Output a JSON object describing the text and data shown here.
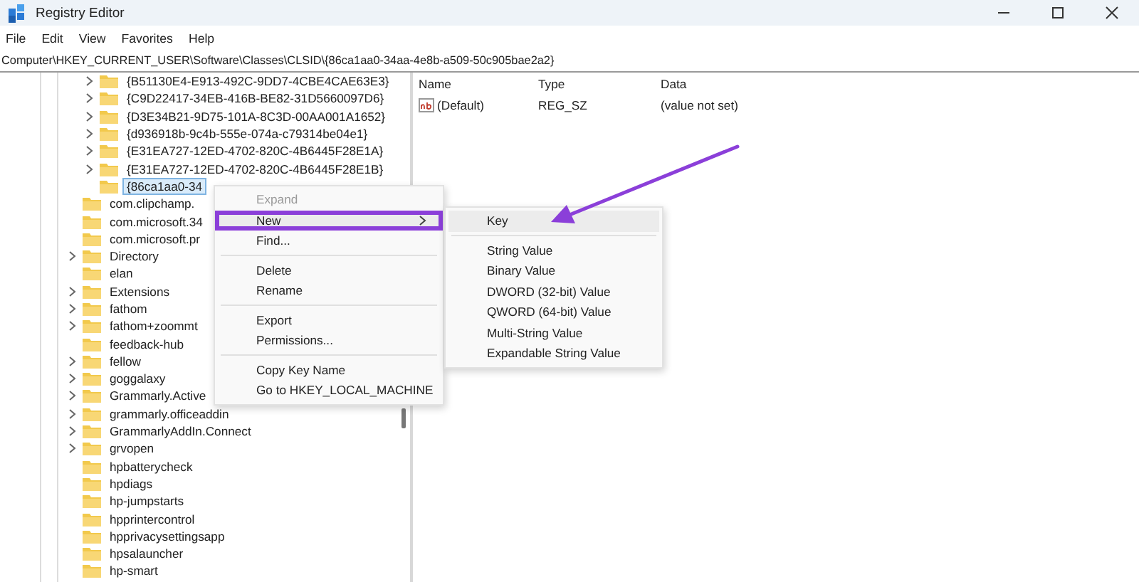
{
  "window": {
    "title": "Registry Editor"
  },
  "menu_bar": [
    "File",
    "Edit",
    "View",
    "Favorites",
    "Help"
  ],
  "address_bar": {
    "value": "Computer\\HKEY_CURRENT_USER\\Software\\Classes\\CLSID\\{86ca1aa0-34aa-4e8b-a509-50c905bae2a2}"
  },
  "tree": {
    "partial_branch": [
      {
        "label": "{B51130E4-E913-492C-9DD7-4CBE4CAE63E3}",
        "expandable": true,
        "selected": false
      },
      {
        "label": "{C9D22417-34EB-416B-BE82-31D5660097D6}",
        "expandable": true,
        "selected": false
      },
      {
        "label": "{D3E34B21-9D75-101A-8C3D-00AA001A1652}",
        "expandable": true,
        "selected": false
      },
      {
        "label": "{d936918b-9c4b-555e-074a-c79314be04e1}",
        "expandable": true,
        "selected": false
      },
      {
        "label": "{E31EA727-12ED-4702-820C-4B6445F28E1A}",
        "expandable": true,
        "selected": false
      },
      {
        "label": "{E31EA727-12ED-4702-820C-4B6445F28E1B}",
        "expandable": true,
        "selected": false
      },
      {
        "label": "{86ca1aa0-34",
        "expandable": false,
        "selected": true
      }
    ],
    "items": [
      {
        "label": "com.clipchamp.",
        "expandable": false,
        "selected": false
      },
      {
        "label": "com.microsoft.34",
        "expandable": false,
        "selected": false
      },
      {
        "label": "com.microsoft.pr",
        "expandable": false,
        "selected": false
      },
      {
        "label": "Directory",
        "expandable": true,
        "selected": false
      },
      {
        "label": "elan",
        "expandable": false,
        "selected": false
      },
      {
        "label": "Extensions",
        "expandable": true,
        "selected": false
      },
      {
        "label": "fathom",
        "expandable": true,
        "selected": false
      },
      {
        "label": "fathom+zoommt",
        "expandable": true,
        "selected": false
      },
      {
        "label": "feedback-hub",
        "expandable": false,
        "selected": false
      },
      {
        "label": "fellow",
        "expandable": true,
        "selected": false
      },
      {
        "label": "goggalaxy",
        "expandable": true,
        "selected": false
      },
      {
        "label": "Grammarly.Active",
        "expandable": true,
        "selected": false
      },
      {
        "label": "grammarly.officeaddin",
        "expandable": true,
        "selected": false
      },
      {
        "label": "GrammarlyAddIn.Connect",
        "expandable": true,
        "selected": false
      },
      {
        "label": "grvopen",
        "expandable": true,
        "selected": false
      },
      {
        "label": "hpbatterycheck",
        "expandable": false,
        "selected": false
      },
      {
        "label": "hpdiags",
        "expandable": false,
        "selected": false
      },
      {
        "label": "hp-jumpstarts",
        "expandable": false,
        "selected": false
      },
      {
        "label": "hpprintercontrol",
        "expandable": false,
        "selected": false
      },
      {
        "label": "hpprivacysettingsapp",
        "expandable": false,
        "selected": false
      },
      {
        "label": "hpsalauncher",
        "expandable": false,
        "selected": false
      },
      {
        "label": "hp-smart",
        "expandable": false,
        "selected": false
      }
    ]
  },
  "values_pane": {
    "columns": [
      "Name",
      "Type",
      "Data"
    ],
    "rows": [
      {
        "name": "(Default)",
        "type": "REG_SZ",
        "data": "(value not set)"
      }
    ]
  },
  "context_menu": {
    "items": [
      {
        "kind": "item",
        "label": "Expand",
        "disabled": true,
        "selected": false,
        "has_submenu": false,
        "outlined": false
      },
      {
        "kind": "item",
        "label": "New",
        "disabled": false,
        "selected": true,
        "has_submenu": true,
        "outlined": true
      },
      {
        "kind": "item",
        "label": "Find...",
        "disabled": false,
        "selected": false,
        "has_submenu": false,
        "outlined": false
      },
      {
        "kind": "separator"
      },
      {
        "kind": "item",
        "label": "Delete",
        "disabled": false,
        "selected": false,
        "has_submenu": false,
        "outlined": false
      },
      {
        "kind": "item",
        "label": "Rename",
        "disabled": false,
        "selected": false,
        "has_submenu": false,
        "outlined": false
      },
      {
        "kind": "separator"
      },
      {
        "kind": "item",
        "label": "Export",
        "disabled": false,
        "selected": false,
        "has_submenu": false,
        "outlined": false
      },
      {
        "kind": "item",
        "label": "Permissions...",
        "disabled": false,
        "selected": false,
        "has_submenu": false,
        "outlined": false
      },
      {
        "kind": "separator"
      },
      {
        "kind": "item",
        "label": "Copy Key Name",
        "disabled": false,
        "selected": false,
        "has_submenu": false,
        "outlined": false
      },
      {
        "kind": "item",
        "label": "Go to HKEY_LOCAL_MACHINE",
        "disabled": false,
        "selected": false,
        "has_submenu": false,
        "outlined": false
      }
    ]
  },
  "submenu": {
    "items": [
      {
        "kind": "item",
        "label": "Key",
        "selected": true
      },
      {
        "kind": "separator"
      },
      {
        "kind": "item",
        "label": "String Value",
        "selected": false
      },
      {
        "kind": "item",
        "label": "Binary Value",
        "selected": false
      },
      {
        "kind": "item",
        "label": "DWORD (32-bit) Value",
        "selected": false
      },
      {
        "kind": "item",
        "label": "QWORD (64-bit) Value",
        "selected": false
      },
      {
        "kind": "item",
        "label": "Multi-String Value",
        "selected": false
      },
      {
        "kind": "item",
        "label": "Expandable String Value",
        "selected": false
      }
    ]
  }
}
